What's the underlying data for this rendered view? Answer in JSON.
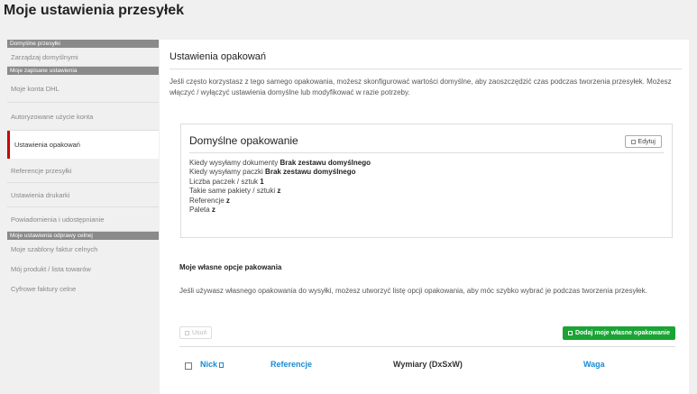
{
  "page": {
    "title": "Moje ustawienia przesyłek"
  },
  "sidebar": {
    "sections": [
      {
        "header": "Domyślne przesyłki",
        "items": [
          {
            "label": "Zarządzaj domyślnymi"
          }
        ]
      },
      {
        "header": "Moje zapisane ustawienia",
        "items": [
          {
            "label": "Moje konta DHL"
          },
          {
            "label": "Autoryzowane użycie konta"
          },
          {
            "label": "Ustawienia opakowań",
            "active": true
          },
          {
            "label": "Referencje przesyłki"
          },
          {
            "label": "Ustawienia drukarki"
          },
          {
            "label": "Powiadomienia i udostępnianie"
          }
        ]
      },
      {
        "header": "Moje ustawienia odprawy celnej",
        "items": [
          {
            "label": "Moje szablony faktur celnych"
          },
          {
            "label": "Mój produkt / lista towarów"
          },
          {
            "label": "Cyfrowe faktury celne"
          }
        ]
      }
    ]
  },
  "main": {
    "section_title": "Ustawienia opakowań",
    "intro": "Jeśli często korzystasz z tego samego opakowania, możesz skonfigurować wartości domyślne, aby zaoszczędzić czas podczas tworzenia przesyłek. Możesz włączyć / wyłączyć ustawienia domyślne lub modyfikować w razie potrzeby.",
    "default_card": {
      "title": "Domyślne opakowanie",
      "edit_label": "Edytuj",
      "lines": [
        {
          "label": "Kiedy wysyłamy dokumenty",
          "value": "Brak zestawu domyślnego"
        },
        {
          "label": "Kiedy wysyłamy paczki",
          "value": "Brak zestawu domyślnego"
        },
        {
          "label": "Liczba paczek / sztuk",
          "value": "1"
        },
        {
          "label": "Takie same pakiety / sztuki",
          "value": "z"
        },
        {
          "label": "Referencje",
          "value": "z"
        },
        {
          "label": "Paleta",
          "value": "z"
        }
      ]
    },
    "own_packaging": {
      "title": "Moje własne opcje pakowania",
      "text": "Jeśli używasz własnego opakowania do wysyłki, możesz utworzyć listę opcji opakowania, aby móc szybko wybrać je podczas tworzenia przesyłek.",
      "delete_label": "Usuń",
      "add_label": "Dodaj moje własne opakowanie"
    },
    "table": {
      "columns": [
        "Nick",
        "Referencje",
        "Wymiary (DxSxW)",
        "Waga"
      ]
    }
  },
  "colors": {
    "accent_red": "#cc0000",
    "add_green": "#1aa434",
    "link_blue": "#1a8ad4",
    "sidebar_header": "#8a8a8a"
  }
}
